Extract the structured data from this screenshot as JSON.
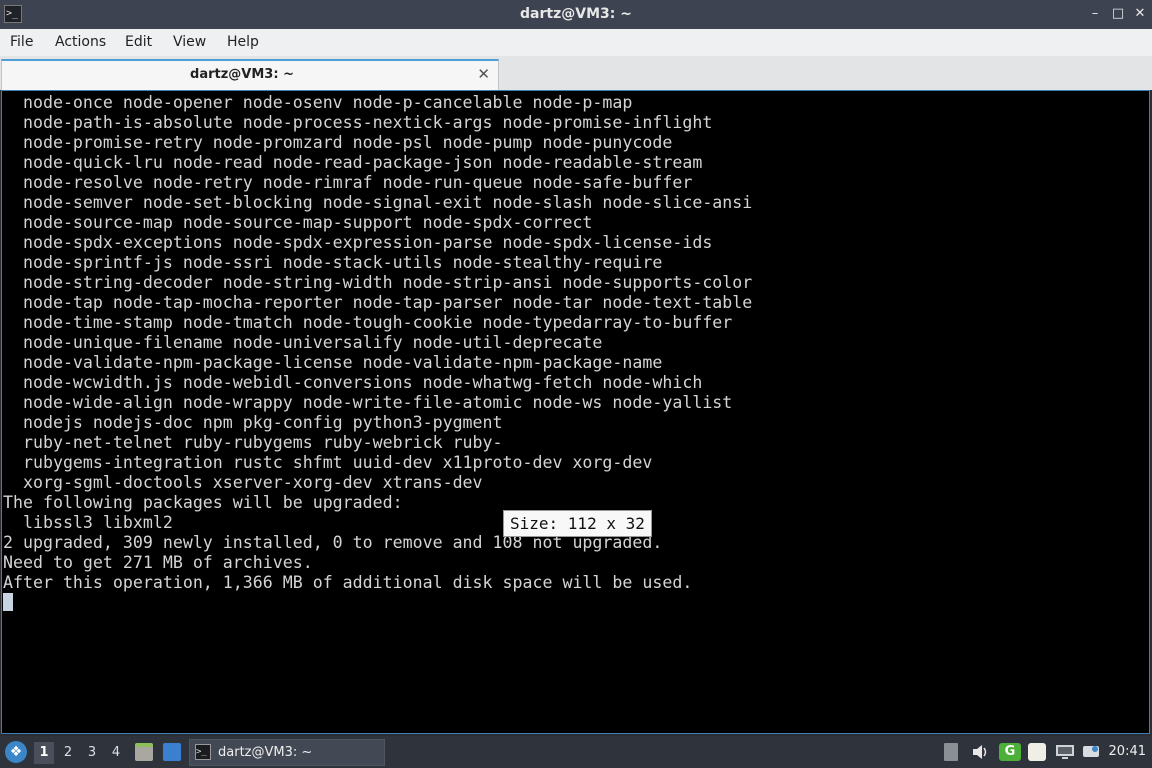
{
  "window": {
    "title": "dartz@VM3: ~"
  },
  "window_controls": {
    "minimize": "–",
    "maximize": "□",
    "close": "✕"
  },
  "menu": [
    "File",
    "Actions",
    "Edit",
    "View",
    "Help"
  ],
  "tab": {
    "label": "dartz@VM3: ~",
    "close": "✕"
  },
  "terminal": {
    "lines": [
      "  node-once node-opener node-osenv node-p-cancelable node-p-map",
      "  node-path-is-absolute node-process-nextick-args node-promise-inflight",
      "  node-promise-retry node-promzard node-psl node-pump node-punycode",
      "  node-quick-lru node-read node-read-package-json node-readable-stream",
      "  node-resolve node-retry node-rimraf node-run-queue node-safe-buffer",
      "  node-semver node-set-blocking node-signal-exit node-slash node-slice-ansi",
      "  node-source-map node-source-map-support node-spdx-correct",
      "  node-spdx-exceptions node-spdx-expression-parse node-spdx-license-ids",
      "  node-sprintf-js node-ssri node-stack-utils node-stealthy-require",
      "  node-string-decoder node-string-width node-strip-ansi node-supports-color",
      "  node-tap node-tap-mocha-reporter node-tap-parser node-tar node-text-table",
      "  node-time-stamp node-tmatch node-tough-cookie node-typedarray-to-buffer",
      "  node-unique-filename node-universalify node-util-deprecate",
      "  node-validate-npm-package-license node-validate-npm-package-name",
      "  node-wcwidth.js node-webidl-conversions node-whatwg-fetch node-which",
      "  node-wide-align node-wrappy node-write-file-atomic node-ws node-yallist",
      "  nodejs nodejs-doc npm pkg-config python3-pygment",
      "  ruby-net-telnet ruby-rubygems ruby-webrick ruby-",
      "  rubygems-integration rustc shfmt uuid-dev x11proto-dev xorg-dev",
      "  xorg-sgml-doctools xserver-xorg-dev xtrans-dev",
      "The following packages will be upgraded:",
      "  libssl3 libxml2",
      "2 upgraded, 309 newly installed, 0 to remove and 108 not upgraded.",
      "Need to get 271 MB of archives.",
      "After this operation, 1,366 MB of additional disk space will be used."
    ],
    "size_tooltip": "Size: 112 x 32"
  },
  "taskbar": {
    "start_icon": "❖",
    "workspaces": [
      "1",
      "2",
      "3",
      "4"
    ],
    "active_workspace": "1",
    "task_label": "dartz@VM3: ~",
    "terminal_glyph": ">_",
    "clock": "20:41"
  }
}
